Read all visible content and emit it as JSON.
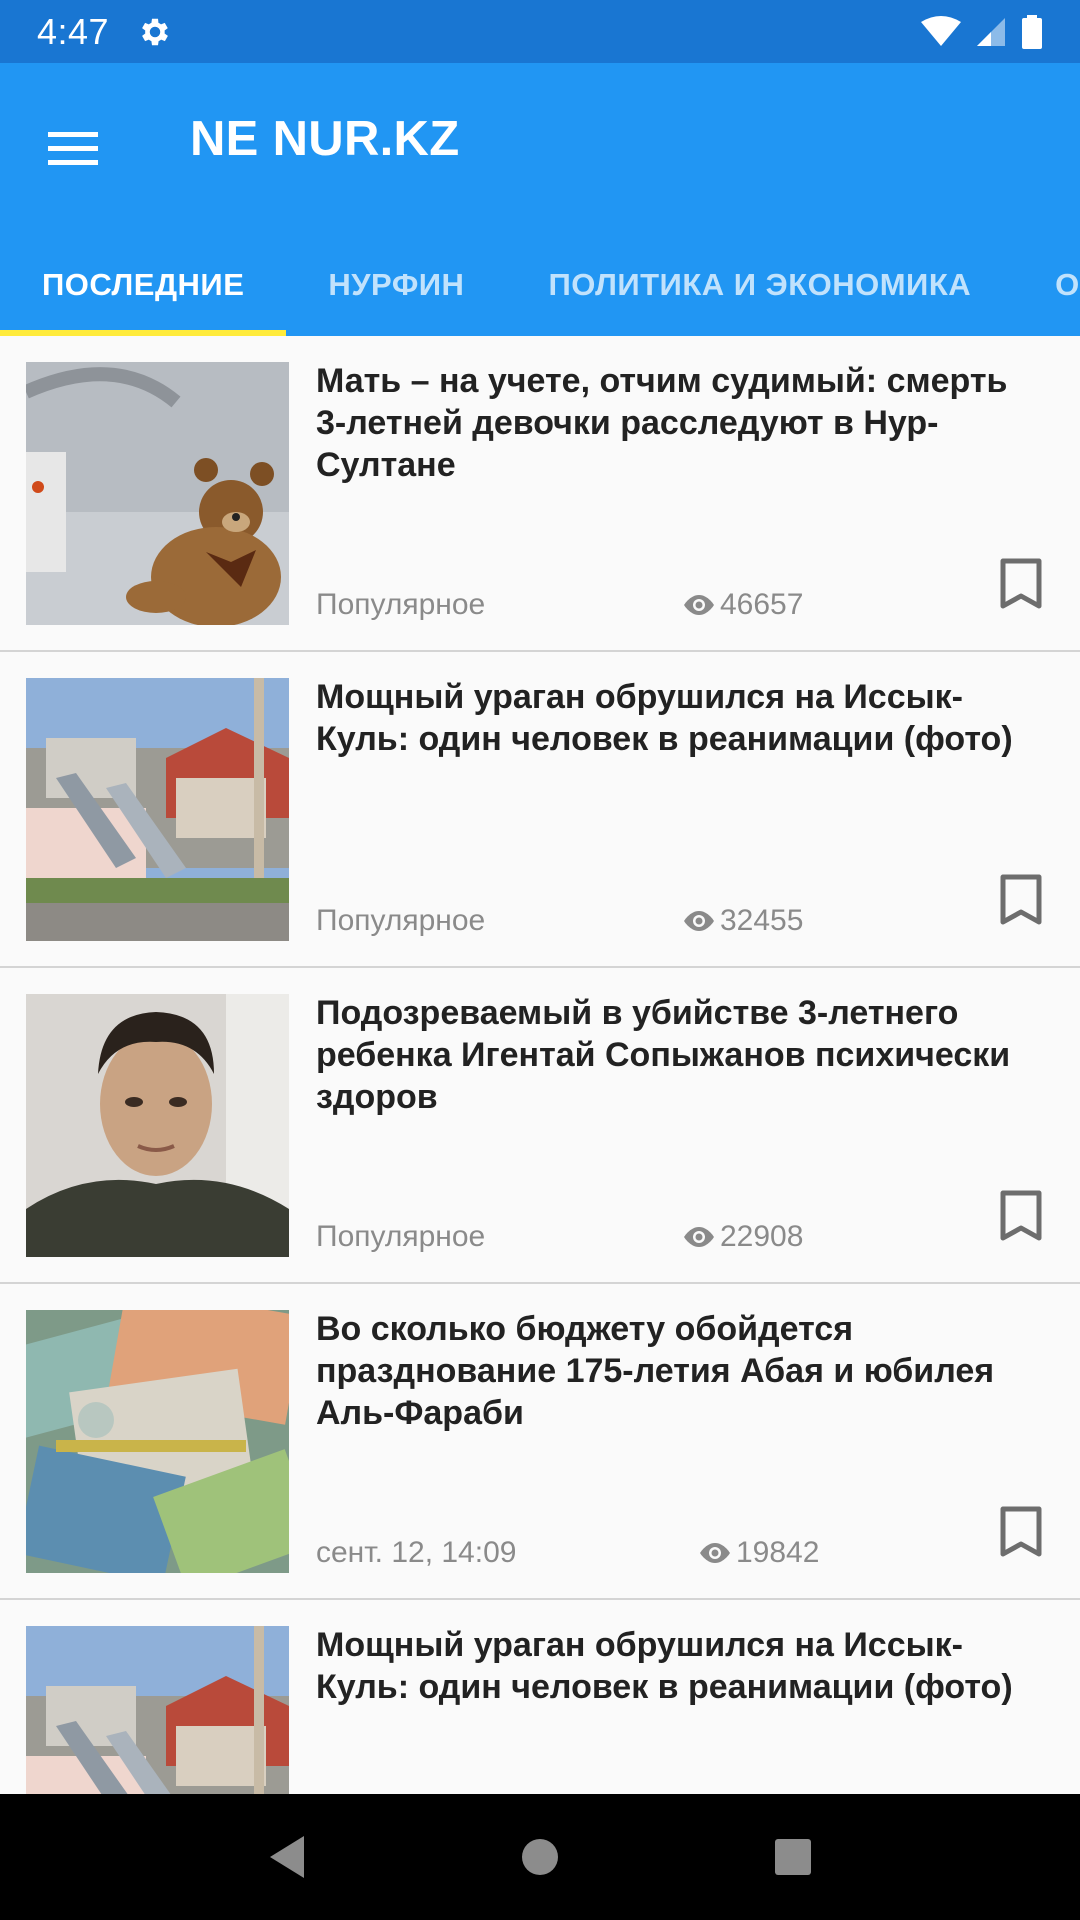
{
  "status_bar": {
    "time": "4:47"
  },
  "app_bar": {
    "title": "NE NUR.KZ",
    "tabs": [
      {
        "label": "ПОСЛЕДНИЕ",
        "active": true
      },
      {
        "label": "НУРФИН",
        "active": false
      },
      {
        "label": "ПОЛИТИКА И ЭКОНОМИКА",
        "active": false
      },
      {
        "label": "ОБЩ",
        "active": false
      }
    ]
  },
  "news": [
    {
      "title": "Мать – на учете, отчим судимый: смерть 3-летней девочки расследуют в Нур-Султане",
      "label": "Популярное",
      "views": "46657",
      "thumb_icon": "teddy-bear-image"
    },
    {
      "title": "Мощный ураган обрушился на Иссык-Куль: один человек в реанимации (фото)",
      "label": "Популярное",
      "views": "32455",
      "thumb_icon": "hurricane-damage-image"
    },
    {
      "title": "Подозреваемый в убийстве 3-летнего ребенка Игентай Сопыжанов психически здоров",
      "label": "Популярное",
      "views": "22908",
      "thumb_icon": "man-portrait-image"
    },
    {
      "title": "Во сколько бюджету обойдется празднование 175-летия Абая и юбилея Аль-Фараби",
      "label": "сент. 12, 14:09",
      "views": "19842",
      "thumb_icon": "banknotes-image"
    },
    {
      "title": "Мощный ураган обрушился на Иссык-Куль: один человек в реанимации (фото)",
      "label": "",
      "views": "",
      "thumb_icon": "hurricane-damage-image"
    }
  ],
  "colors": {
    "status_bar": "#1976d2",
    "app_bar": "#2196f3",
    "tab_indicator": "#ffeb3b",
    "background": "#fafafa"
  }
}
